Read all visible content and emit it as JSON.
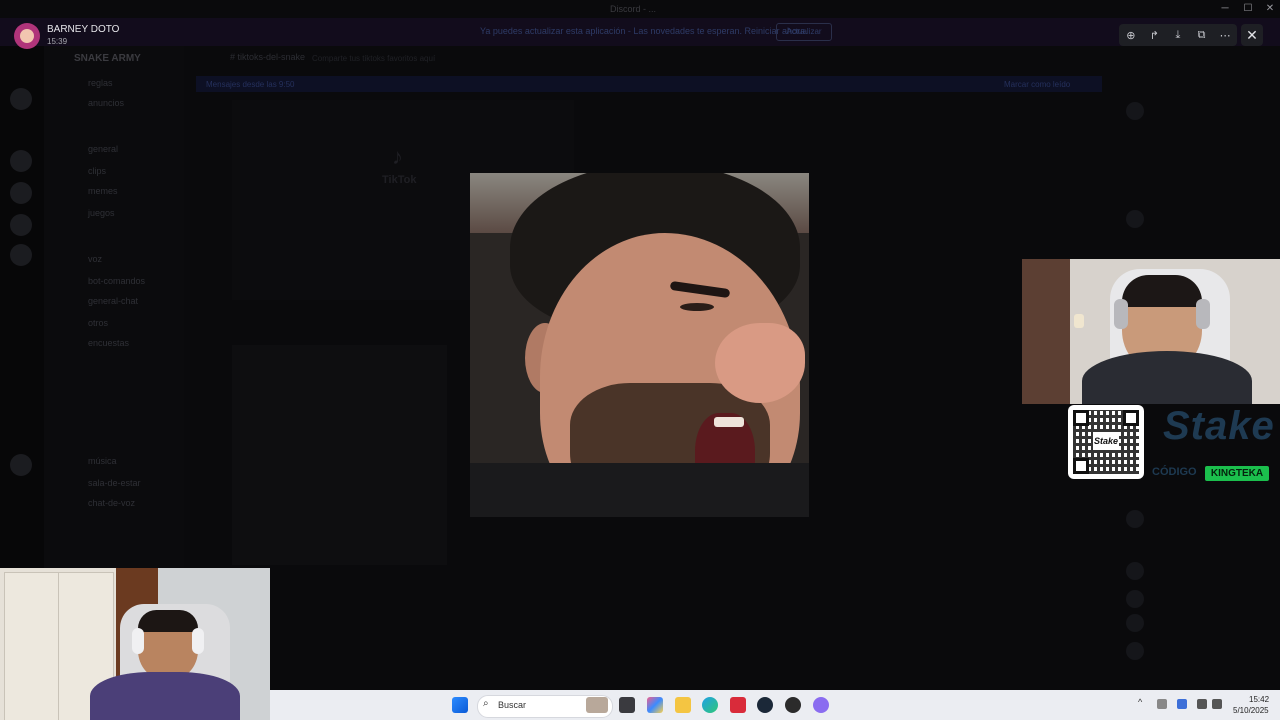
{
  "window": {
    "title": "Discord - ...",
    "controls": [
      "minimize",
      "maximize",
      "close"
    ]
  },
  "uploader": {
    "name": "BARNEY DOTO",
    "time": "15:39"
  },
  "background": {
    "banner_text": "Ya puedes actualizar esta aplicación - Las novedades te esperan. Reiniciar ahora.",
    "banner_button": "Actualizar",
    "server_name": "SNAKE ARMY",
    "channels": [
      "reglas",
      "anuncios",
      "general",
      "clips",
      "memes",
      "juegos",
      "voz",
      "bot-comandos",
      "general-chat",
      "otros",
      "encuestas",
      "música",
      "sala-de-estar",
      "chat-de-voz"
    ],
    "chat_header": "# tiktoks-del-snake",
    "chat_header_sub": "Comparte tus tiktoks favoritos aquí",
    "pinned_text": "Mensajes desde las 9:50",
    "pinned_right": "Marcar como leído",
    "tiktok_label": "TikTok"
  },
  "viewer_toolbar": {
    "tools": [
      {
        "name": "zoom-icon",
        "glyph": "⊕"
      },
      {
        "name": "forward-icon",
        "glyph": "↱"
      },
      {
        "name": "download-icon",
        "glyph": "⤓"
      },
      {
        "name": "open-external-icon",
        "glyph": "⧉"
      },
      {
        "name": "more-icon",
        "glyph": "⋯"
      }
    ],
    "close_glyph": "✕"
  },
  "stake_ad": {
    "qr_logo": "Stake",
    "logo_text": "Stake",
    "code_label": "CÓDIGO",
    "code": "KINGTEKA"
  },
  "taskbar": {
    "search_placeholder": "Buscar",
    "search_glyph": "⌕",
    "apps": [
      "start-icon",
      "file-explorer-icon",
      "copilot-icon",
      "folder-icon",
      "edge-icon",
      "office-icon",
      "steam-icon",
      "chrome-icon",
      "discord-icon"
    ],
    "tray_arrow": "^",
    "time": "15:42",
    "date": "5/10/2025"
  },
  "colors": {
    "stake_green": "#1bbf4d",
    "stake_blue": "#1e3a52",
    "discord_dark": "#0a0a0c"
  }
}
